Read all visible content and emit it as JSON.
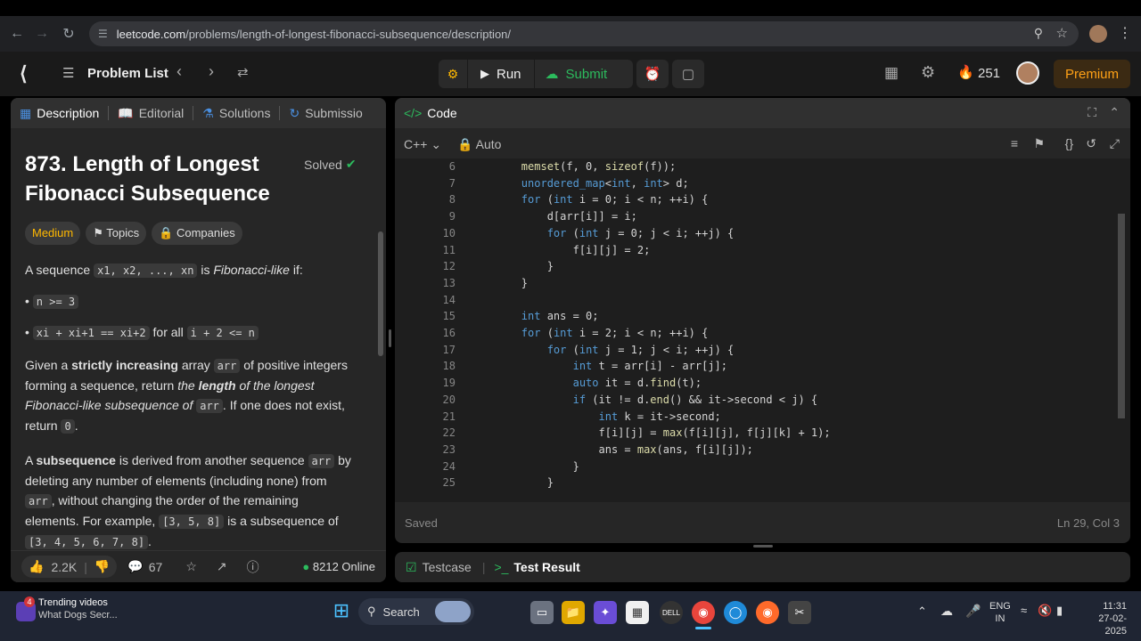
{
  "browser": {
    "url_host": "leetcode.com",
    "url_path": "/problems/length-of-longest-fibonacci-subsequence/description/"
  },
  "toolbar": {
    "problem_list": "Problem List",
    "run": "Run",
    "submit": "Submit",
    "streak": "251",
    "premium": "Premium"
  },
  "left_tabs": [
    "Description",
    "Editorial",
    "Solutions",
    "Submissio"
  ],
  "problem": {
    "title_line1": "873. Length of Longest",
    "title_line2": "Fibonacci Subsequence",
    "solved": "Solved",
    "difficulty": "Medium",
    "topics": "Topics",
    "companies": "Companies",
    "p1_a": "A sequence",
    "p1_code": "x1, x2, ..., xn",
    "p1_b": "is",
    "p1_c": "Fibonacci-like",
    "p1_d": "if:",
    "b1_code": "n >= 3",
    "b2_code": "xi + xi+1 == xi+2",
    "b2_text": "for all",
    "b2_code2": "i + 2 <= n",
    "p2_l1a": "Given a",
    "p2_l1b": "strictly increasing",
    "p2_l1c": "array",
    "p2_l1d": "arr",
    "p2_l1e": "of positive integers",
    "p2_l2a": "forming a sequence, return",
    "p2_l2b": "the",
    "p2_l2c": "length",
    "p2_l2d": "of the longest",
    "p2_l3a": "Fibonacci-like subsequence of",
    "p2_l3b": "arr",
    "p2_l3c": ". If one does not exist,",
    "p2_l4a": "return",
    "p2_l4b": "0",
    "p2_l4c": ".",
    "p3_l1a": "A",
    "p3_l1b": "subsequence",
    "p3_l1c": "is derived from another sequence",
    "p3_l1d": "arr",
    "p3_l1e": "by",
    "p3_l2": "deleting any number of elements (including none) from",
    "p3_l3a": "arr",
    "p3_l3b": ", without changing the order of the remaining",
    "p3_l4a": "elements. For example,",
    "p3_l4b": "[3, 5, 8]",
    "p3_l4c": "is a subsequence of",
    "p3_l5a": "[3, 4, 5, 6, 7, 8]",
    "p3_l5b": "."
  },
  "footer": {
    "likes": "2.2K",
    "comments": "67",
    "online": "8212 Online"
  },
  "code_panel": {
    "title": "Code",
    "lang": "C++",
    "mode": "Auto",
    "saved": "Saved",
    "position": "Ln 29, Col 3",
    "lines": [
      {
        "n": "6",
        "t": "        memset(f, 0, sizeof(f));"
      },
      {
        "n": "7",
        "t": "        unordered_map<int, int> d;"
      },
      {
        "n": "8",
        "t": "        for (int i = 0; i < n; ++i) {"
      },
      {
        "n": "9",
        "t": "            d[arr[i]] = i;"
      },
      {
        "n": "10",
        "t": "            for (int j = 0; j < i; ++j) {"
      },
      {
        "n": "11",
        "t": "                f[i][j] = 2;"
      },
      {
        "n": "12",
        "t": "            }"
      },
      {
        "n": "13",
        "t": "        }"
      },
      {
        "n": "14",
        "t": ""
      },
      {
        "n": "15",
        "t": "        int ans = 0;"
      },
      {
        "n": "16",
        "t": "        for (int i = 2; i < n; ++i) {"
      },
      {
        "n": "17",
        "t": "            for (int j = 1; j < i; ++j) {"
      },
      {
        "n": "18",
        "t": "                int t = arr[i] - arr[j];"
      },
      {
        "n": "19",
        "t": "                auto it = d.find(t);"
      },
      {
        "n": "20",
        "t": "                if (it != d.end() && it->second < j) {"
      },
      {
        "n": "21",
        "t": "                    int k = it->second;"
      },
      {
        "n": "22",
        "t": "                    f[i][j] = max(f[i][j], f[j][k] + 1);"
      },
      {
        "n": "23",
        "t": "                    ans = max(ans, f[i][j]);"
      },
      {
        "n": "24",
        "t": "                }"
      },
      {
        "n": "25",
        "t": "            }"
      }
    ]
  },
  "bottom_tabs": {
    "testcase": "Testcase",
    "test_result": "Test Result"
  },
  "taskbar": {
    "trending_title": "Trending videos",
    "trending_sub": "What Dogs Secr...",
    "badge": "4",
    "search": "Search",
    "lang1": "ENG",
    "lang2": "IN",
    "time": "11:31",
    "date": "27-02-2025"
  },
  "colors": {
    "accent_orange": "#ffa116",
    "submit_green": "#2cbb5d",
    "medium": "#ffb800"
  }
}
